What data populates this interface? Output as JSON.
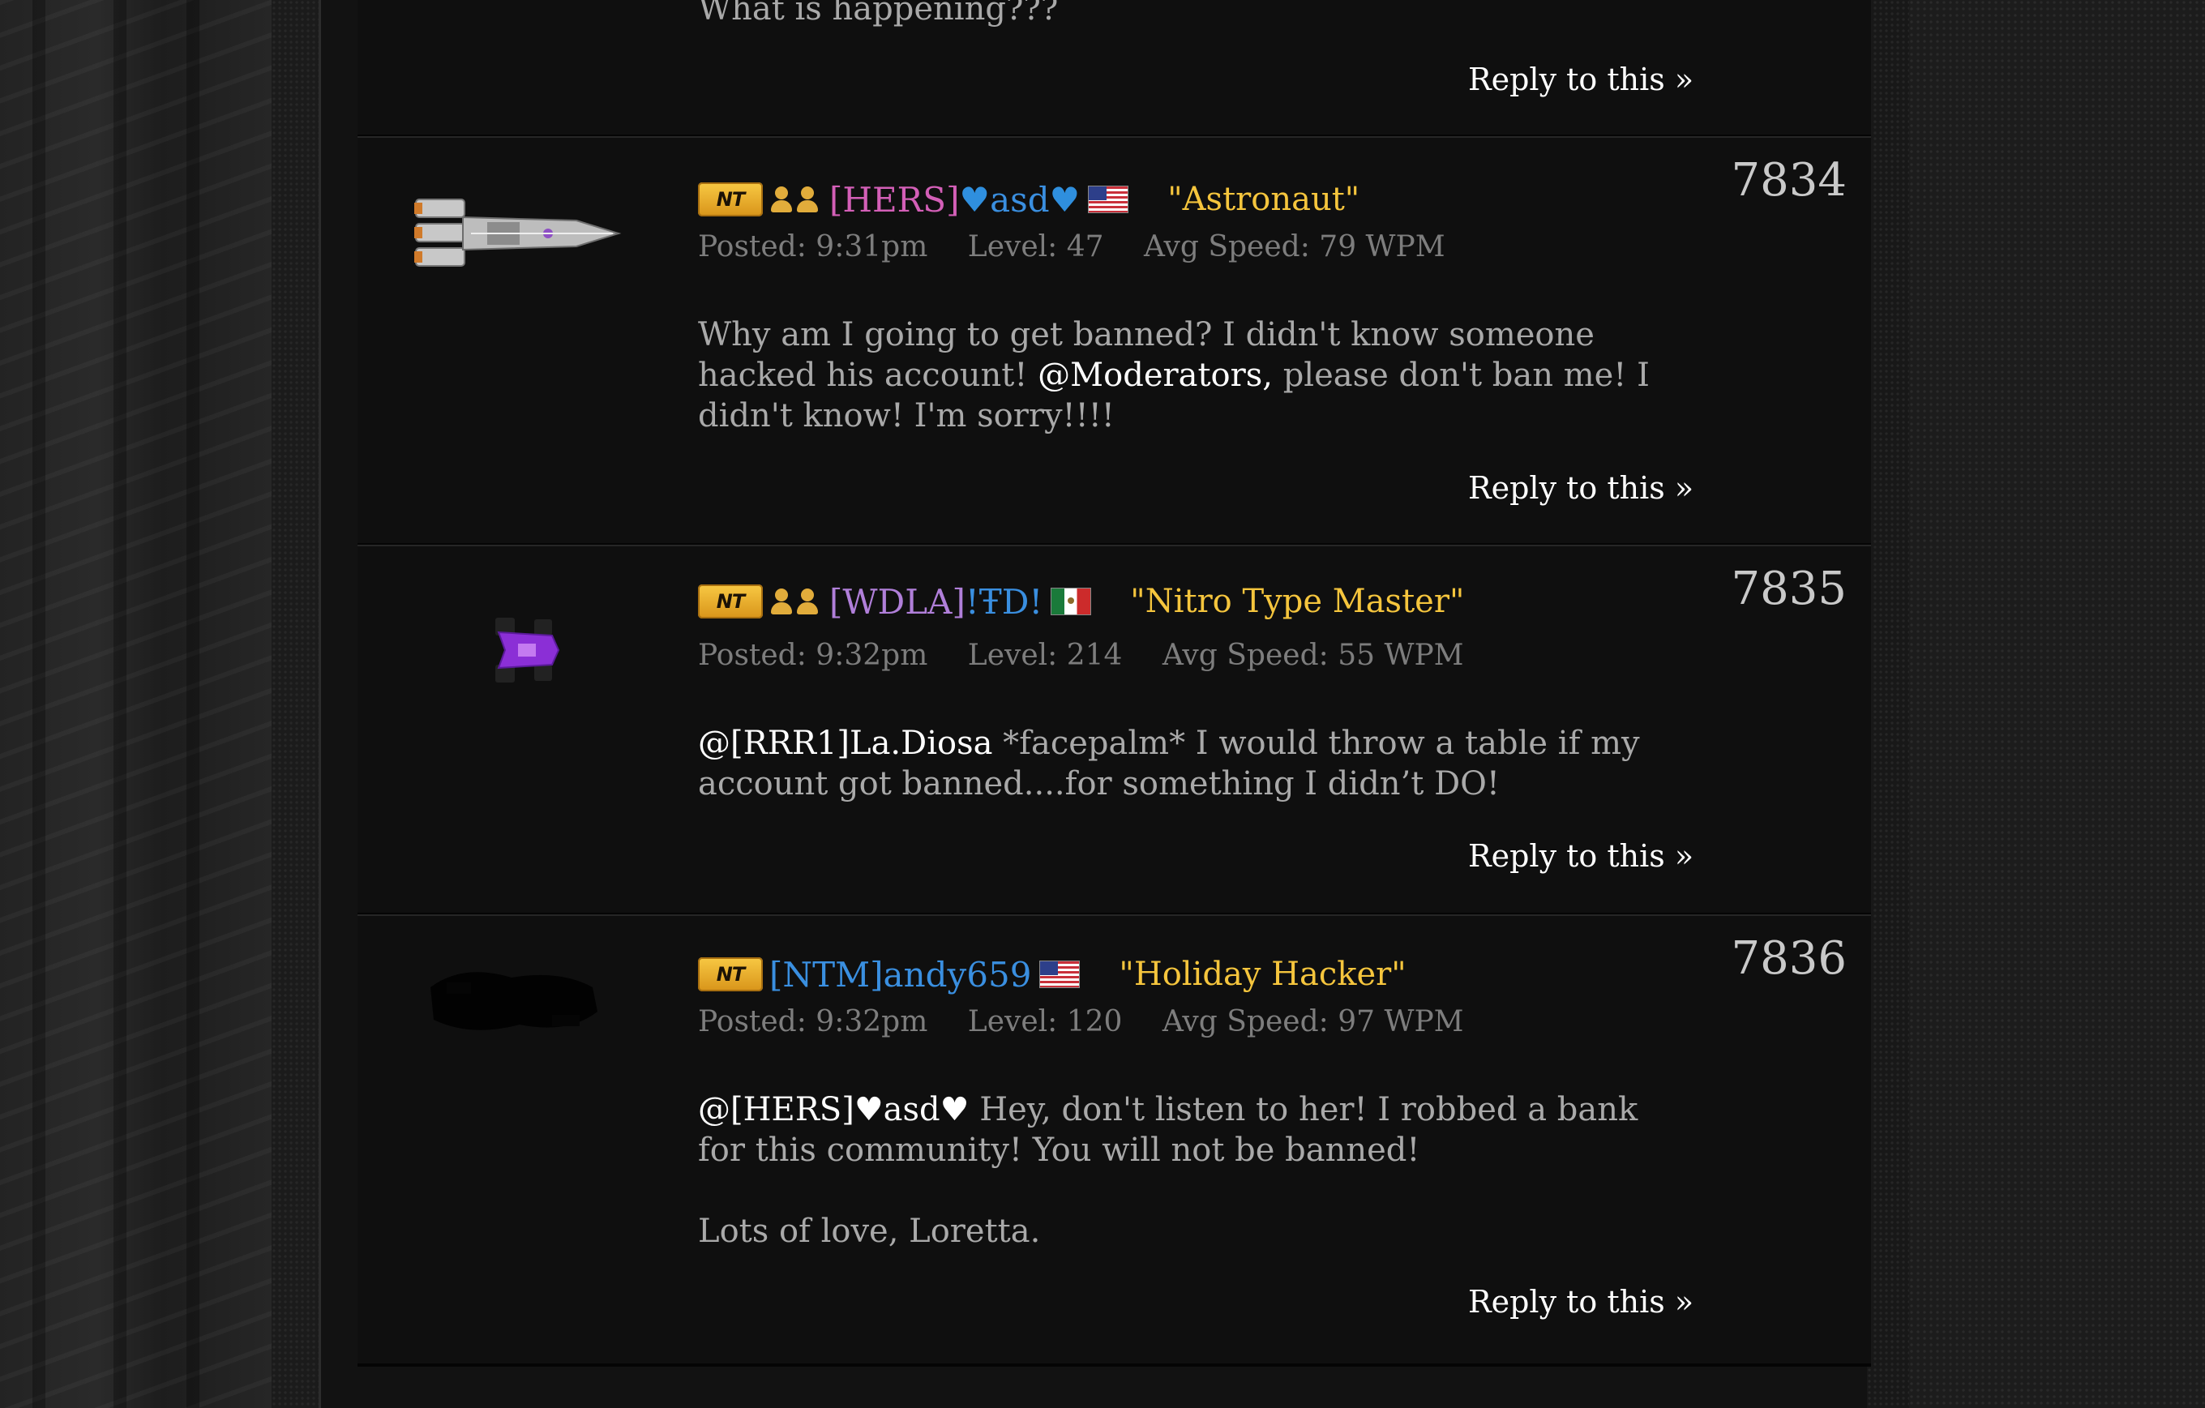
{
  "top_post": {
    "body_tail": "What is happening???",
    "reply_label": "Reply to this »"
  },
  "posts": [
    {
      "number": "7834",
      "tag": "[HERS]",
      "name": "asd",
      "title": "\"Astronaut\"",
      "posted": "Posted: 9:31pm",
      "level": "Level: 47",
      "speed": "Avg Speed: 79 WPM",
      "body_1": "Why am I going to get banned? I didn't know someone hacked his account! ",
      "mention": "@Moderators,",
      "body_2": " please don't ban me! I didn't know! I'm sorry!!!!",
      "reply_label": "Reply to this »",
      "name_color": "#d35fb7",
      "heart_color": "#2f8fde",
      "flag": "us"
    },
    {
      "number": "7835",
      "tag": "[WDLA]",
      "name": "!ŦD!",
      "title": "\"Nitro Type Master\"",
      "posted": "Posted: 9:32pm",
      "level": "Level: 214",
      "speed": "Avg Speed: 55 WPM",
      "mention": "@[RRR1]La.Diosa",
      "body_1": " *facepalm* I would throw a table if my account got banned....for something I didn’t DO!",
      "reply_label": "Reply to this »",
      "tag_color": "#b07fd9",
      "name_color": "#3a8fe0",
      "flag": "mx"
    },
    {
      "number": "7836",
      "tag": "[NTM]",
      "name": "andy659",
      "title": "\"Holiday Hacker\"",
      "posted": "Posted: 9:32pm",
      "level": "Level: 120",
      "speed": "Avg Speed: 97 WPM",
      "mention": "@[HERS]♥asd♥",
      "body_1": " Hey, don't listen to her! I robbed a bank for this community! You will not be banned!",
      "body_2": "Lots of love, Loretta.",
      "reply_label": "Reply to this »",
      "name_color": "#3a8fe0",
      "flag": "us"
    }
  ],
  "badge_label": "NT",
  "colors": {
    "title_gold": "#f5c53d",
    "meta_gray": "#7d7d7d",
    "body_gray": "#a9a9a9",
    "panel_bg": "#0f0f0f"
  }
}
